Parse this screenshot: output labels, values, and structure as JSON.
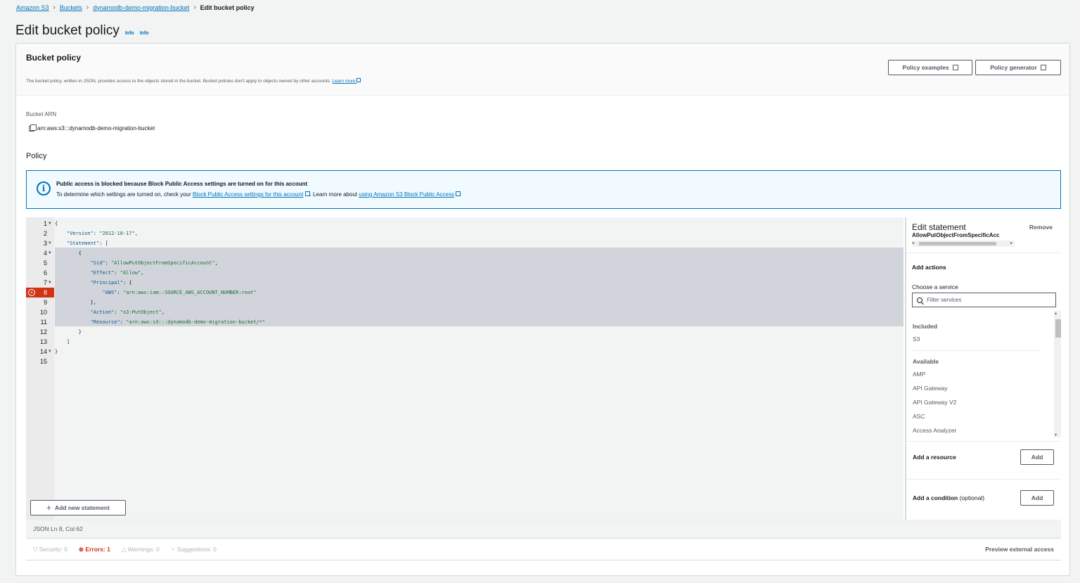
{
  "breadcrumb": {
    "items": [
      "Amazon S3",
      "Buckets",
      "dynamodb-demo-migration-bucket"
    ],
    "current": "Edit bucket policy"
  },
  "page": {
    "title": "Edit bucket policy",
    "info1": "Info",
    "info2": "Info"
  },
  "bucket_policy": {
    "title": "Bucket policy",
    "description": "The bucket policy, written in JSON, provides access to the objects stored in the bucket. Bucket policies don't apply to objects owned by other accounts.",
    "learn_more": "Learn more",
    "policy_examples": "Policy examples",
    "policy_generator": "Policy generator"
  },
  "arn": {
    "label": "Bucket ARN",
    "value": "arn:aws:s3:::dynamodb-demo-migration-bucket"
  },
  "policy_label": "Policy",
  "alert": {
    "title": "Public access is blocked because Block Public Access settings are turned on for this account",
    "text_prefix": "To determine which settings are turned on, check your",
    "link1": "Block Public Access settings for this account",
    "text_mid": ". Learn more about",
    "link2": "using Amazon S3 Block Public Access"
  },
  "editor": {
    "lines": [
      {
        "n": "1",
        "fold": "▼"
      },
      {
        "n": "2",
        "fold": ""
      },
      {
        "n": "3",
        "fold": "▼"
      },
      {
        "n": "4",
        "fold": "▼"
      },
      {
        "n": "5",
        "fold": ""
      },
      {
        "n": "6",
        "fold": ""
      },
      {
        "n": "7",
        "fold": "▼"
      },
      {
        "n": "8",
        "fold": "",
        "error": true
      },
      {
        "n": "9",
        "fold": ""
      },
      {
        "n": "10",
        "fold": ""
      },
      {
        "n": "11",
        "fold": ""
      },
      {
        "n": "12",
        "fold": ""
      },
      {
        "n": "13",
        "fold": ""
      },
      {
        "n": "14",
        "fold": "▼"
      },
      {
        "n": "15",
        "fold": ""
      }
    ],
    "code": {
      "l1": "{",
      "l2_key": "\"Version\"",
      "l2_val": "\"2012-10-17\"",
      "l3_key": "\"Statement\"",
      "l3_rest": ": [",
      "l4": "{",
      "l5_key": "\"Sid\"",
      "l5_val": "\"AllowPutObjectFromSpecificAccount\"",
      "l6_key": "\"Effect\"",
      "l6_val": "\"Allow\"",
      "l7_key": "\"Principal\"",
      "l7_rest": ": {",
      "l8_key": "\"AWS\"",
      "l8_val": "\"arn:aws:iam::SOURCE_AWS_ACCOUNT_NUMBER:root\"",
      "l9": "},",
      "l10_key": "\"Action\"",
      "l10_val": "\"s3:PutObject\"",
      "l11_key": "\"Resource\"",
      "l11_val": "\"arn:aws:s3:::dynamodb-demo-migration-bucket/*\"",
      "l12": "}",
      "l13": "]",
      "l14": "}",
      "colon": ": ",
      "comma": ","
    },
    "add_statement": "Add new statement",
    "status": "JSON  Ln 8, Col 62"
  },
  "footer": {
    "security": "Security: 0",
    "errors": "Errors: 1",
    "warnings": "Warnings: 0",
    "suggestions": "Suggestions: 0",
    "preview": "Preview external access"
  },
  "side_panel": {
    "title": "Edit statement",
    "statement_id": "AllowPutObjectFromSpecificAcc",
    "remove": "Remove",
    "add_actions": "Add actions",
    "choose_service": "Choose a service",
    "filter_placeholder": "Filter services",
    "included_label": "Included",
    "included": [
      "S3"
    ],
    "available_label": "Available",
    "available": [
      "AMP",
      "API Gateway",
      "API Gateway V2",
      "ASC",
      "Access Analyzer"
    ],
    "add_resource": "Add a resource",
    "add_condition": "Add a condition",
    "optional": "(optional)",
    "add_btn": "Add"
  },
  "colors": {
    "link": "#0073bb",
    "error": "#d13212",
    "selection": "#d1d5db"
  }
}
